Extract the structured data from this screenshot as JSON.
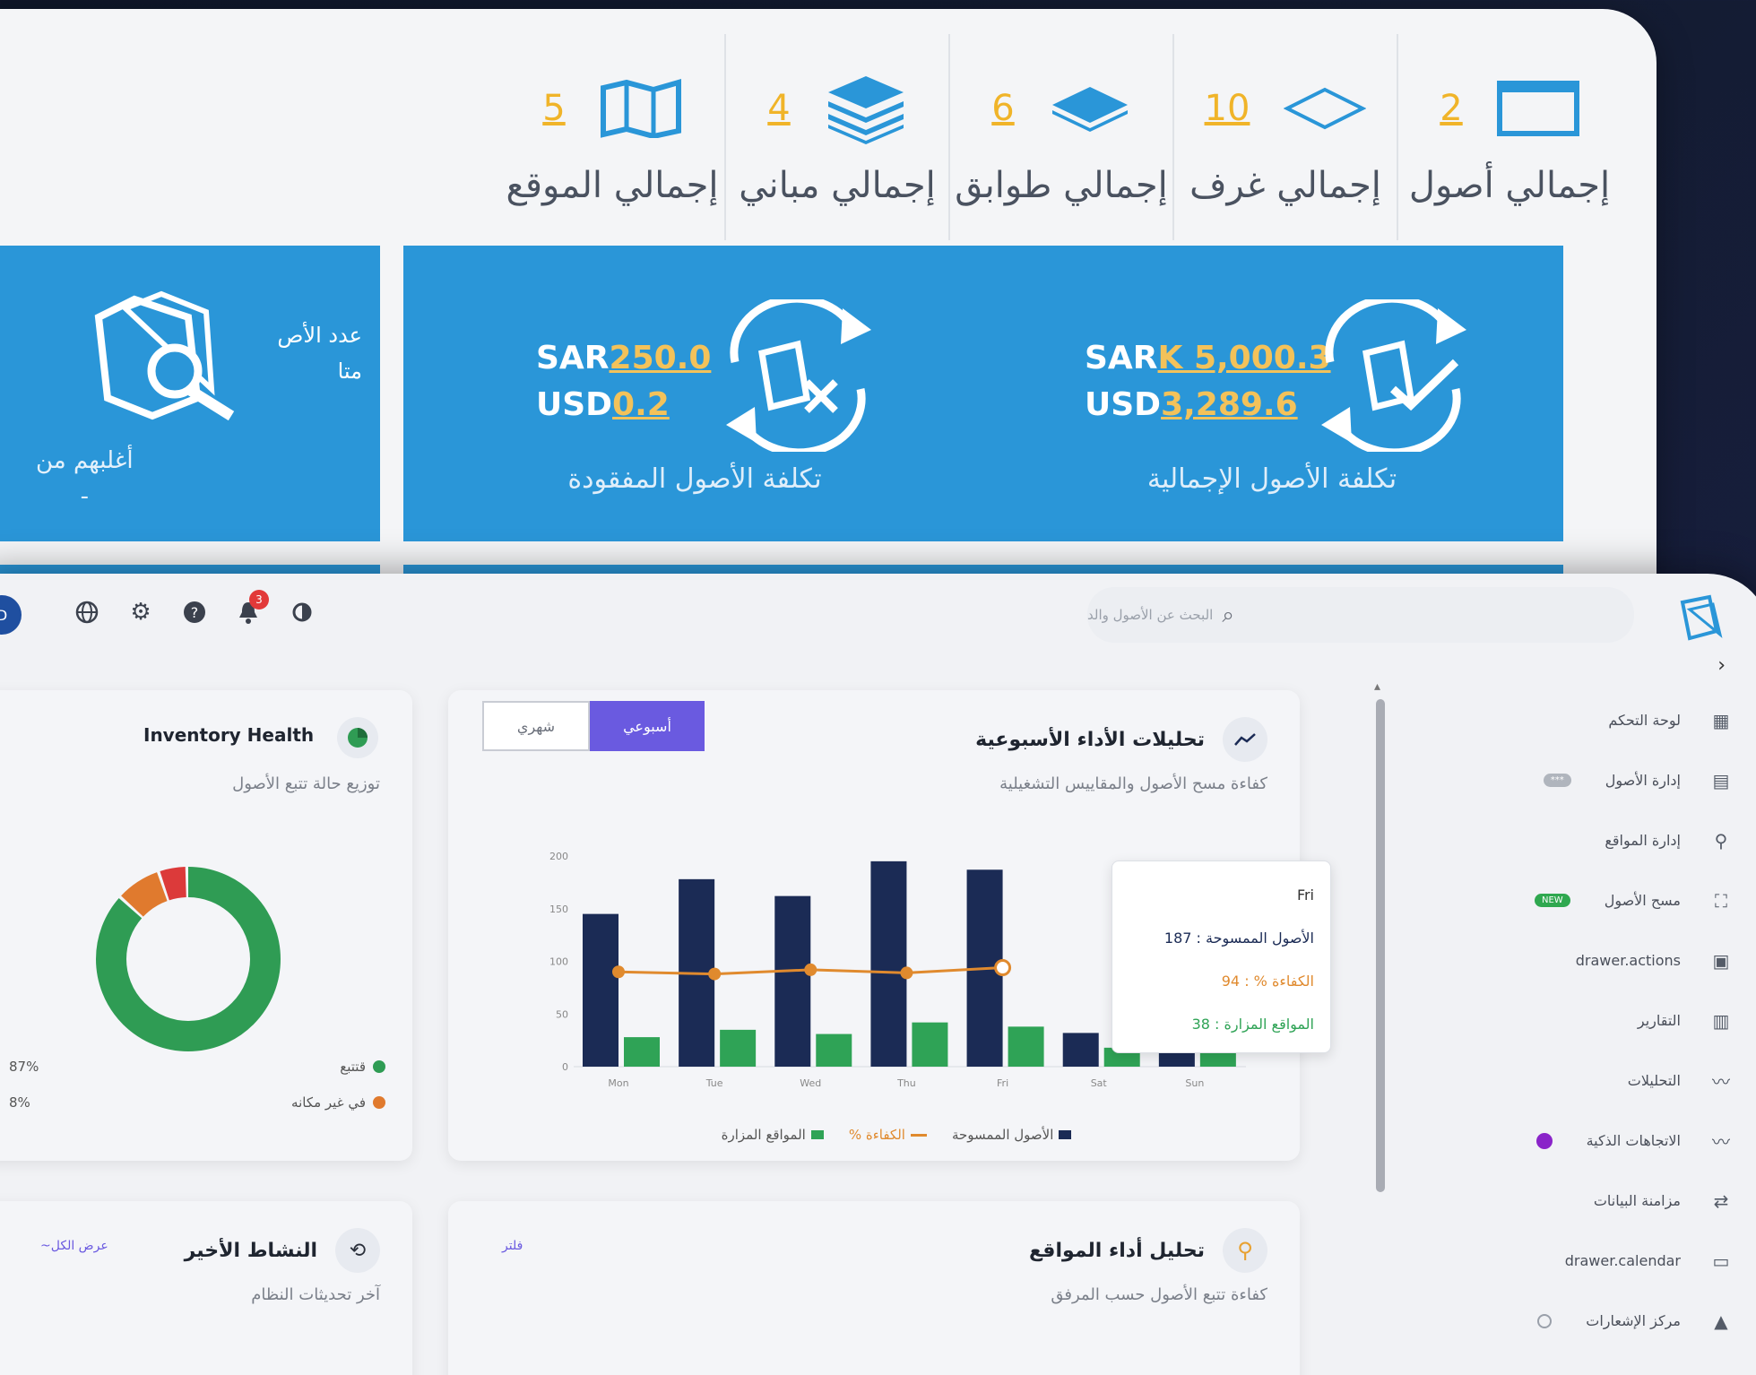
{
  "summary": {
    "stats": [
      {
        "label": "إجمالي أصول",
        "value": "2",
        "icon": "monitor-icon"
      },
      {
        "label": "إجمالي غرف",
        "value": "10",
        "icon": "room-outline-icon"
      },
      {
        "label": "إجمالي طوابق",
        "value": "6",
        "icon": "floor-layer-icon"
      },
      {
        "label": "إجمالي مباني",
        "value": "4",
        "icon": "stacked-layers-icon"
      },
      {
        "label": "إجمالي الموقع",
        "value": "5",
        "icon": "map-icon"
      }
    ],
    "cards": {
      "total_cost": {
        "title": "تكلفة الأصول الإجمالية",
        "sar_prefix": "SAR",
        "sar_value": "K 5,000.3",
        "usd_prefix": "USD",
        "usd_value": "3,289.6"
      },
      "lost_cost": {
        "title": "تكلفة الأصول المفقودة",
        "sar_prefix": "SAR",
        "sar_value": "250.0",
        "usd_prefix": "USD",
        "usd_value": "0.2"
      },
      "third": {
        "line1": "عدد الأص",
        "line2": "متا",
        "sub1": "أغلبهم من",
        "sub2": "-"
      }
    }
  },
  "topbar": {
    "search_placeholder": "البحث عن الأصول والد",
    "avatar_text": "D",
    "notification_count": "3"
  },
  "sidebar": {
    "items": [
      {
        "label": "لوحة التحكم",
        "icon": "dashboard-grid-icon"
      },
      {
        "label": "إدارة الأصول",
        "icon": "archive-icon",
        "pill": "***"
      },
      {
        "label": "إدارة المواقع",
        "icon": "location-pin-icon"
      },
      {
        "label": "مسح الأصول",
        "icon": "scan-icon",
        "pill": "NEW"
      },
      {
        "label": "drawer.actions",
        "icon": "actions-icon"
      },
      {
        "label": "التقارير",
        "icon": "report-icon"
      },
      {
        "label": "التحليلات",
        "icon": "trend-line-icon"
      },
      {
        "label": "الاتجاهات الذكية",
        "icon": "trend-line-icon"
      },
      {
        "label": "مزامنة البيانات",
        "icon": "sync-icon"
      },
      {
        "label": "drawer.calendar",
        "icon": "calendar-icon"
      },
      {
        "label": "مركز الإشعارات",
        "icon": "bell-icon"
      }
    ]
  },
  "analytics": {
    "title": "تحليلات الأداء الأسبوعية",
    "subtitle": "كفاءة مسح الأصول والمقاييس التشغيلية",
    "toggle_weekly": "أسبوعي",
    "toggle_monthly": "شهري",
    "tooltip": {
      "day": "Fri",
      "line1": "الأصول الممسوحة : 187",
      "line2": "الكفاءة % : 94",
      "line3": "المواقع المزارة : 38"
    }
  },
  "chart_data": {
    "type": "bar",
    "categories": [
      "Mon",
      "Tue",
      "Wed",
      "Thu",
      "Fri",
      "Sat",
      "Sun"
    ],
    "series": [
      {
        "name": "الأصول الممسوحة",
        "type": "bar",
        "color": "#1b2b55",
        "values": [
          145,
          178,
          162,
          195,
          187,
          32,
          38
        ]
      },
      {
        "name": "الكفاءة %",
        "type": "line",
        "color": "#e08a2e",
        "values": [
          90,
          88,
          92,
          89,
          94,
          null,
          null
        ]
      },
      {
        "name": "المواقع المزارة",
        "type": "bar",
        "color": "#2fa356",
        "values": [
          28,
          35,
          31,
          42,
          38,
          18,
          13
        ]
      }
    ],
    "y_ticks": [
      "0",
      "50",
      "100",
      "150",
      "200"
    ],
    "ylim": [
      0,
      200
    ],
    "legend_position": "bottom"
  },
  "inventory": {
    "title": "Inventory Health",
    "subtitle": "توزيع حالة تتبع الأصول",
    "legend": [
      {
        "label": "قتتبع",
        "value": "87%",
        "color": "#2f9c54"
      },
      {
        "label": "في غير مكانه",
        "value": "8%",
        "color": "#e07a2e"
      }
    ],
    "donut": [
      {
        "value": 87,
        "color": "#2f9c54"
      },
      {
        "value": 8,
        "color": "#e07a2e"
      },
      {
        "value": 5,
        "color": "#dc3a3a"
      }
    ]
  },
  "activity": {
    "title": "النشاط الأخير",
    "subtitle": "آخر تحديثات النظام",
    "link": "عرض الكل~"
  },
  "sites": {
    "title": "تحليل أداء المواقع",
    "subtitle": "كفاءة تتبع الأصول حسب المرفق",
    "link": "فلتر"
  }
}
